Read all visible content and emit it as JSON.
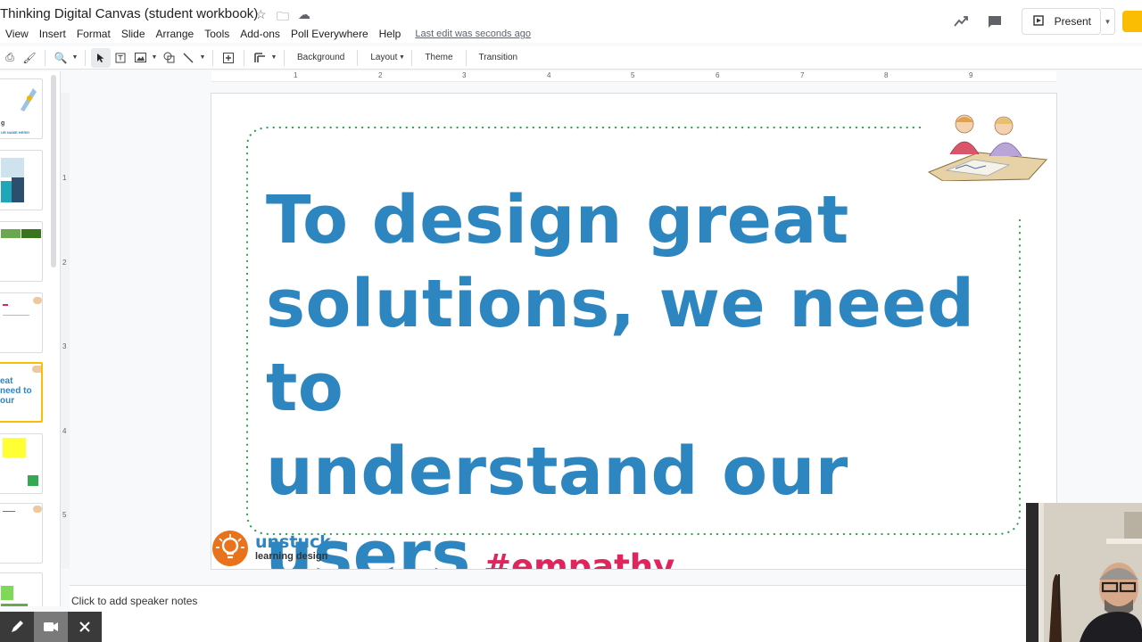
{
  "doc": {
    "title": "Thinking Digital Canvas (student workbook)"
  },
  "menu": {
    "items": [
      "View",
      "Insert",
      "Format",
      "Slide",
      "Arrange",
      "Tools",
      "Add-ons",
      "Poll Everywhere",
      "Help"
    ],
    "last_edit": "Last edit was seconds ago"
  },
  "top_right": {
    "present_label": "Present"
  },
  "toolbar": {
    "background_label": "Background",
    "layout_label": "Layout",
    "theme_label": "Theme",
    "transition_label": "Transition"
  },
  "ruler": {
    "h_marks": [
      "1",
      "2",
      "3",
      "4",
      "5",
      "6",
      "7",
      "8",
      "9"
    ],
    "v_marks": [
      "1",
      "2",
      "3",
      "4",
      "5"
    ]
  },
  "filmstrip": {
    "thumb1_text": "UR NAME HERE!",
    "thumb5_text": "eat\nneed to\nour"
  },
  "slide": {
    "line1": "To design great",
    "line2": "solutions, we need to",
    "line3": "understand our",
    "line4": "users",
    "hashtag": "#empathy",
    "logo_title": "unstuck",
    "logo_sub": "learning design"
  },
  "notes": {
    "placeholder": "Click to add speaker notes"
  },
  "colors": {
    "headline": "#2e86c1",
    "hashtag": "#e0245e",
    "dotted_border": "#2e9e4f",
    "logo_orange": "#e8731c"
  }
}
